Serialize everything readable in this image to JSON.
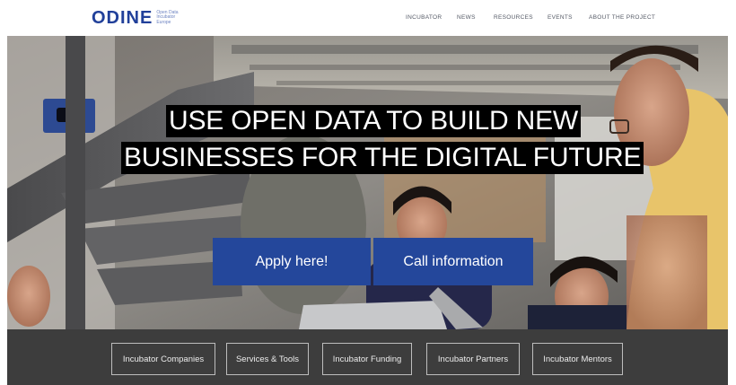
{
  "header": {
    "logo": {
      "word": "ODINE",
      "tagline": [
        "Open Data",
        "Incubator",
        "Europe"
      ]
    },
    "nav": [
      "INCUBATOR",
      "NEWS",
      "RESOURCES",
      "EVENTS",
      "ABOUT THE PROJECT"
    ]
  },
  "hero": {
    "headline": [
      "USE OPEN DATA TO BUILD NEW",
      "BUSINESSES FOR THE DIGITAL FUTURE"
    ],
    "buttons": {
      "apply": "Apply here!",
      "call": "Call information"
    },
    "colors": {
      "button": "#24479b",
      "headline_bg": "#000000"
    }
  },
  "links": [
    "Incubator Companies",
    "Services & Tools",
    "Incubator Funding",
    "Incubator Partners",
    "Incubator Mentors"
  ],
  "colors": {
    "brand": "#21409a",
    "linkbar": "#3d3d3d"
  }
}
